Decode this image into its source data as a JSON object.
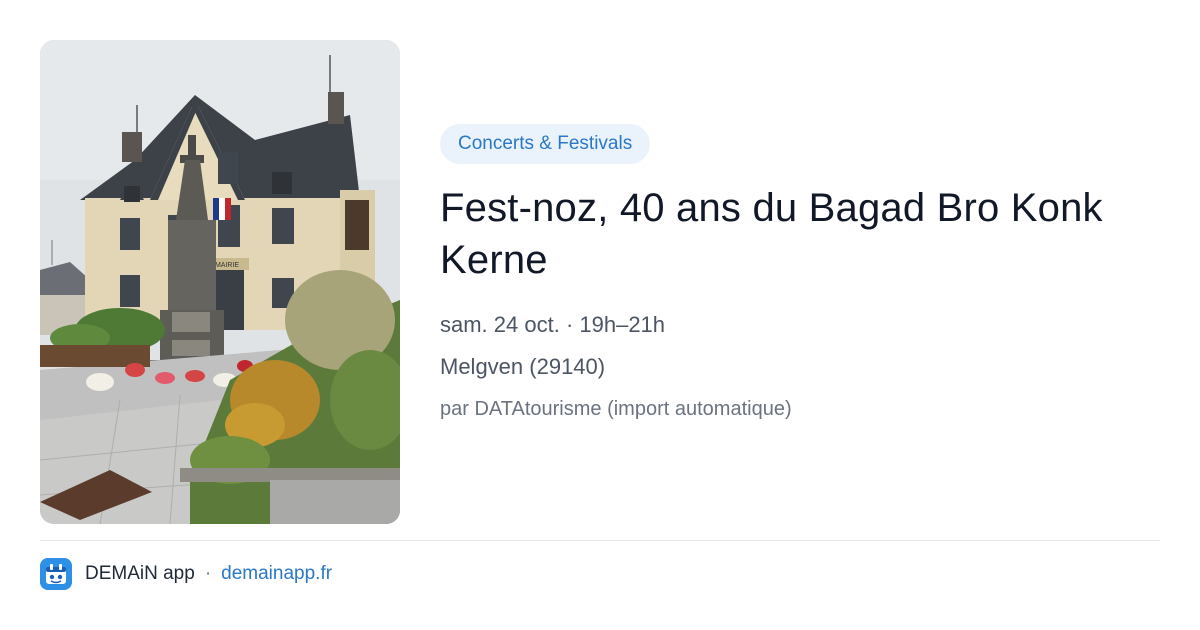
{
  "event": {
    "category": "Concerts & Festivals",
    "title": "Fest-noz, 40 ans du Bagad Bro Konk Kerne",
    "datetime": "sam. 24 oct. · 19h–21h",
    "location": "Melgven (29140)",
    "source": "par DATAtourisme (import automatique)",
    "image_sign": "MAIRIE"
  },
  "footer": {
    "app_name": "DEMAiN app",
    "separator": "·",
    "link": "demainapp.fr",
    "icon": "demain-app-icon"
  },
  "colors": {
    "accent": "#2a78c7",
    "chip_bg": "#eaf3fc",
    "title": "#111827",
    "meta": "#4b5563",
    "app_icon": "#2d8fe6"
  }
}
